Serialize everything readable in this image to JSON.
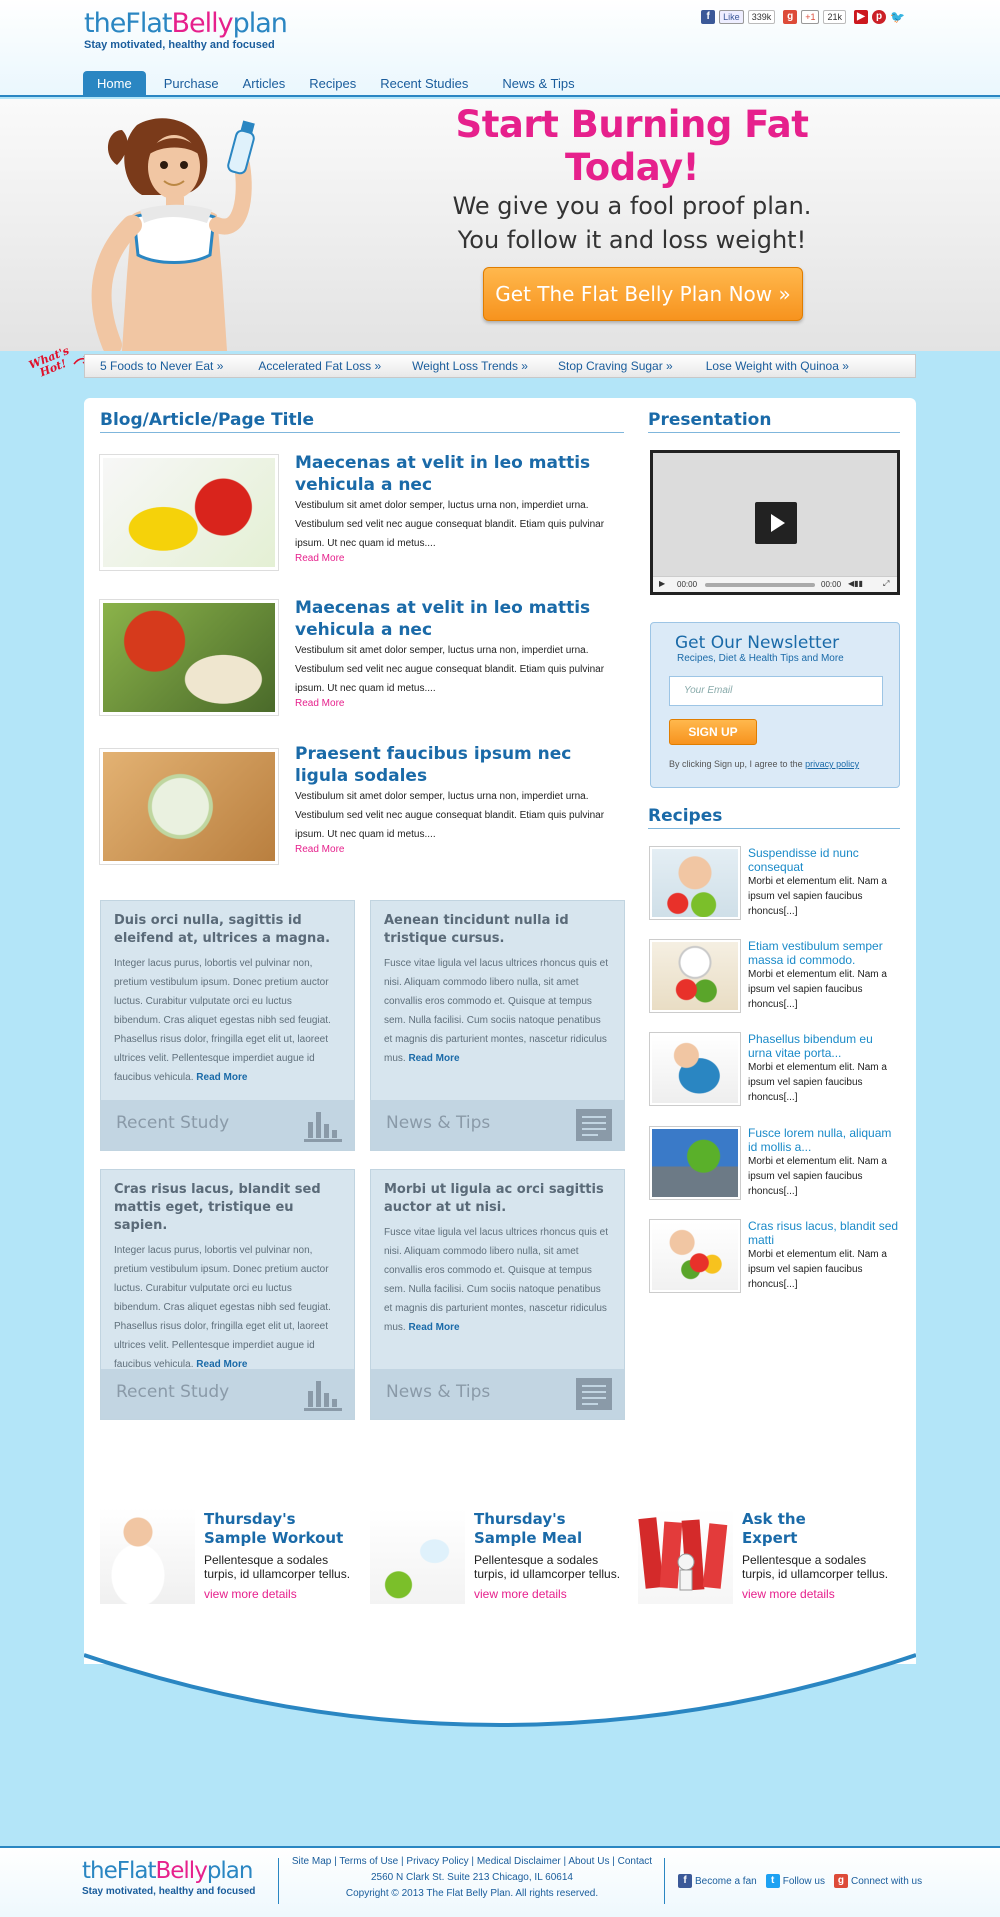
{
  "brand": {
    "logo_part1": "theFlat",
    "logo_part2": "Belly",
    "logo_part3": "plan",
    "tagline": "Stay motivated, healthy and focused"
  },
  "social": {
    "like_label": "Like",
    "like_count": "339k",
    "plusone_label": "+1",
    "plusone_count": "21k",
    "icons": [
      "facebook-icon",
      "google-plus-icon",
      "youtube-icon",
      "pinterest-icon",
      "twitter-icon"
    ]
  },
  "nav": [
    "Home",
    "Purchase",
    "Articles",
    "Recipes",
    "Recent Studies",
    "News & Tips"
  ],
  "hero": {
    "title": "Start Burning Fat Today!",
    "line1": "We give you a fool proof plan.",
    "line2": "You follow it and loss weight!",
    "cta": "Get The Flat Belly Plan Now »"
  },
  "hot": {
    "badge_line1": "What's",
    "badge_line2": "Hot!",
    "links": [
      "5 Foods to Never Eat »",
      "Accelerated Fat Loss »",
      "Weight Loss Trends »",
      "Stop Craving Sugar »",
      "Lose Weight with Quinoa »"
    ]
  },
  "main": {
    "page_title": "Blog/Article/Page Title",
    "articles": [
      {
        "title": "Maecenas at velit in leo mattis vehicula a nec",
        "body": "Vestibulum sit amet dolor semper, luctus urna non, imperdiet urna. Vestibulum sed velit nec augue consequat blandit. Etiam quis pulvinar ipsum. Ut nec quam id metus....",
        "read_more": "Read More"
      },
      {
        "title": "Maecenas at velit in leo mattis vehicula a nec",
        "body": "Vestibulum sit amet dolor semper, luctus urna non, imperdiet urna. Vestibulum sed velit nec augue consequat blandit. Etiam quis pulvinar ipsum. Ut nec quam id metus....",
        "read_more": "Read More"
      },
      {
        "title": "Praesent faucibus ipsum nec ligula sodales",
        "body": "Vestibulum sit amet dolor semper, luctus urna non, imperdiet urna. Vestibulum sed velit nec augue consequat blandit. Etiam quis pulvinar ipsum. Ut nec quam id metus....",
        "read_more": "Read More"
      }
    ],
    "cards": [
      {
        "title": "Duis orci nulla, sagittis id eleifend at, ultrices a magna.",
        "body": "Integer lacus purus, lobortis vel pulvinar non, pretium vestibulum ipsum. Donec pretium auctor luctus. Curabitur vulputate orci eu luctus bibendum. Cras aliquet egestas nibh sed feugiat. Phasellus risus dolor, fringilla eget elit ut, laoreet ultrices velit. Pellentesque imperdiet augue id faucibus vehicula.",
        "more": "Read More",
        "footer": "Recent Study",
        "icon": "bar-chart-icon"
      },
      {
        "title": "Aenean tincidunt nulla id tristique cursus.",
        "body": "Fusce vitae ligula vel lacus ultrices rhoncus quis et nisi. Aliquam commodo libero nulla, sit amet convallis eros commodo et. Quisque at tempus sem. Nulla facilisi. Cum sociis natoque penatibus et magnis dis parturient montes, nascetur ridiculus mus.",
        "more": "Read More",
        "footer": "News & Tips",
        "icon": "newspaper-icon"
      },
      {
        "title": "Cras risus lacus, blandit sed mattis eget, tristique eu sapien.",
        "body": "Integer lacus purus, lobortis vel pulvinar non, pretium vestibulum ipsum. Donec pretium auctor luctus. Curabitur vulputate orci eu luctus bibendum. Cras aliquet egestas nibh sed feugiat. Phasellus risus dolor, fringilla eget elit ut, laoreet ultrices velit. Pellentesque imperdiet augue id faucibus vehicula.",
        "more": "Read More",
        "footer": "Recent Study",
        "icon": "bar-chart-icon"
      },
      {
        "title": "Morbi ut ligula ac orci sagittis auctor at ut nisi.",
        "body": "Fusce vitae ligula vel lacus ultrices rhoncus quis et nisi. Aliquam commodo libero nulla, sit amet convallis eros commodo et. Quisque at tempus sem. Nulla facilisi. Cum sociis natoque penatibus et magnis dis parturient montes, nascetur ridiculus mus.",
        "more": "Read More",
        "footer": "News & Tips",
        "icon": "newspaper-icon"
      }
    ],
    "features": [
      {
        "title1": "Thursday's",
        "title2": "Sample Workout",
        "body": "Pellentesque a sodales turpis, id ullamcorper tellus.",
        "link": "view more details"
      },
      {
        "title1": "Thursday's",
        "title2": "Sample Meal",
        "body": "Pellentesque a sodales turpis, id ullamcorper tellus.",
        "link": "view more details"
      },
      {
        "title1": "Ask the",
        "title2": "Expert",
        "body": "Pellentesque a sodales turpis, id ullamcorper tellus.",
        "link": "view more details"
      }
    ]
  },
  "sidebar": {
    "presentation_title": "Presentation",
    "video": {
      "current_time": "00:00",
      "duration": "00:00"
    },
    "newsletter": {
      "title": "Get Our Newsletter",
      "subtitle": "Recipes, Diet & Health Tips and More",
      "placeholder": "Your Email",
      "button": "SIGN UP",
      "note_prefix": "By clicking  Sign up,  I agree to the",
      "note_link": "privacy policy"
    },
    "recipes_title": "Recipes",
    "recipes": [
      {
        "title": "Suspendisse id nunc consequat",
        "body": "Morbi et elementum elit. Nam a ipsum vel sapien faucibus rhoncus[...]"
      },
      {
        "title": "Etiam vestibulum semper massa id commodo.",
        "body": "Morbi et elementum elit. Nam a ipsum vel sapien faucibus rhoncus[...]"
      },
      {
        "title": "Phasellus bibendum eu urna vitae porta...",
        "body": "Morbi et elementum elit. Nam a ipsum vel sapien faucibus rhoncus[...]"
      },
      {
        "title": "Fusce lorem nulla, aliquam id mollis a...",
        "body": "Morbi et elementum elit. Nam a ipsum vel sapien faucibus rhoncus[...]"
      },
      {
        "title": "Cras risus lacus, blandit sed matti",
        "body": "Morbi et elementum elit. Nam a ipsum vel sapien faucibus rhoncus[...]"
      }
    ]
  },
  "footer": {
    "links": [
      "Site Map",
      "Terms of Use",
      "Privacy Policy",
      "Medical Disclaimer",
      "About Us",
      "Contact"
    ],
    "address": "2560 N Clark St. Suite 213 Chicago, IL 60614",
    "copyright": "Copyright © 2013 The Flat Belly Plan. All rights reserved.",
    "social": [
      "Become a fan",
      "Follow us",
      "Connect with us"
    ]
  },
  "colors": {
    "brand_blue": "#2a86c2",
    "brand_pink": "#e6208c",
    "cta_orange": "#f7931e",
    "page_bg": "#b3e5f8"
  }
}
